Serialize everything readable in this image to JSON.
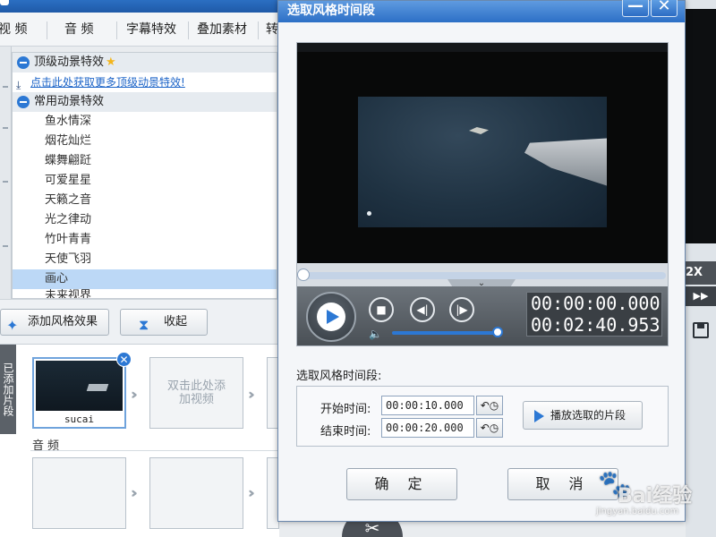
{
  "background": {
    "tabs": [
      "视 频",
      "音 频",
      "字幕特效",
      "叠加素材",
      "转"
    ],
    "effects": {
      "top_group_label": "顶级动景特效",
      "promo_link": "点击此处获取更多顶级动景特效!",
      "common_group_label": "常用动景特效",
      "items": [
        "鱼水情深",
        "烟花灿烂",
        "蝶舞翩跹",
        "可爱星星",
        "天籁之音",
        "光之律动",
        "竹叶青青",
        "天使飞羽",
        "画心",
        "未来视界"
      ],
      "selected_index": 8
    },
    "add_style_button": "添加风格效果",
    "collapse_button": "收起",
    "timeline_side_label": "已添加片段",
    "clip_name": "sucai",
    "empty_clip_hint": "双击此处添加视频",
    "audio_label": "音频",
    "speed_label": "2X"
  },
  "dialog": {
    "title": "选取风格时间段",
    "min_label": "—",
    "close_label": "✕",
    "current_time": "00:00:00.000",
    "total_time": "00:02:40.953",
    "volume": 0.95,
    "section_label": "选取风格时间段:",
    "start_label": "开始时间:",
    "start_value": "00:00:10.000",
    "end_label": "结束时间:",
    "end_value": "00:00:20.000",
    "play_segment_button": "播放选取的片段",
    "ok_button": "确 定",
    "cancel_button": "取 消"
  },
  "watermark": {
    "brand": "Bai经验",
    "url": "jingyan.baidu.com"
  }
}
